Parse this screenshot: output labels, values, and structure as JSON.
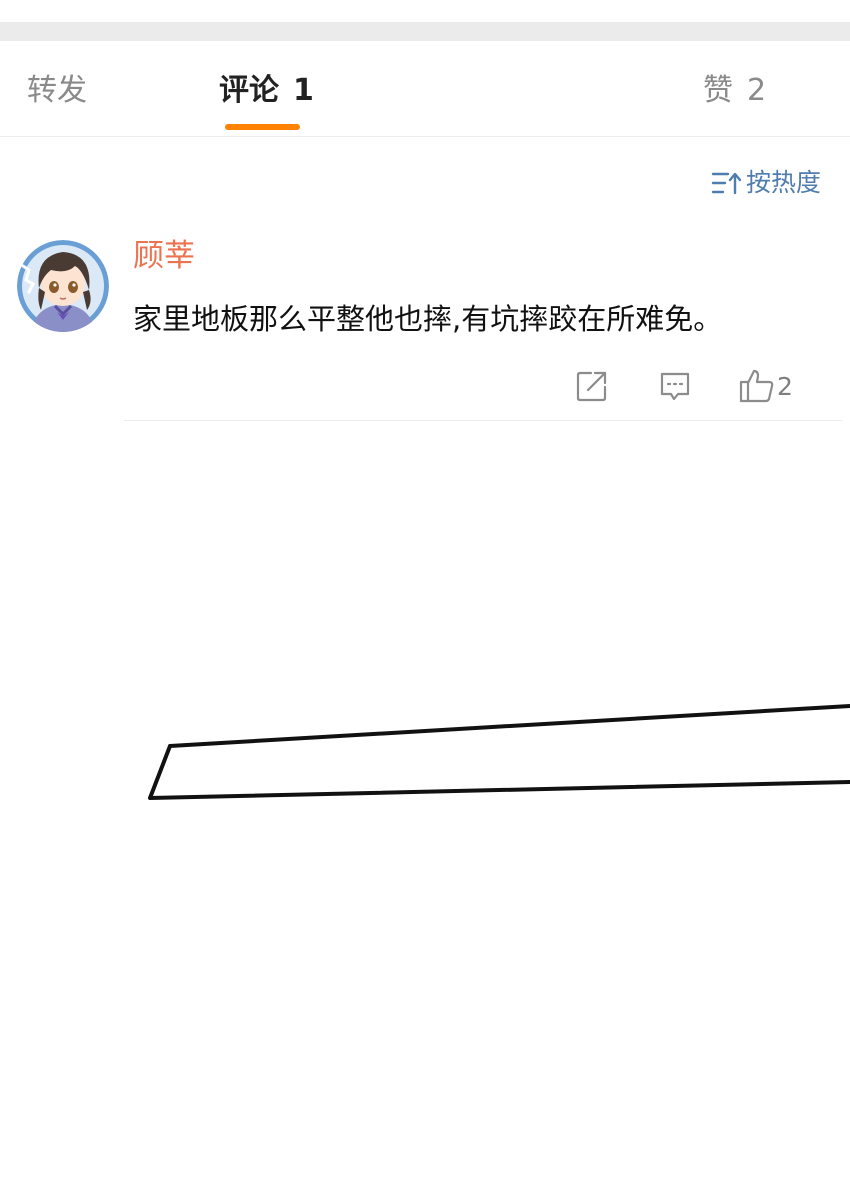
{
  "tabs": {
    "repost": {
      "label": "转发"
    },
    "comments": {
      "label": "评论",
      "count": "1"
    },
    "likes": {
      "label": "赞",
      "count": "2"
    }
  },
  "sort": {
    "label": "按热度",
    "icon": "sort-icon"
  },
  "comment": {
    "author": "顾莘",
    "text": "家里地板那么平整他也摔,有坑摔跤在所难免。",
    "like_count": "2",
    "actions": [
      "share-icon",
      "reply-icon",
      "thumbs-up-icon"
    ]
  },
  "colors": {
    "accent": "#ff8200",
    "author": "#eb7350",
    "link": "#507daf",
    "icon": "#8c8c8c",
    "separator": "#ebebeb"
  }
}
